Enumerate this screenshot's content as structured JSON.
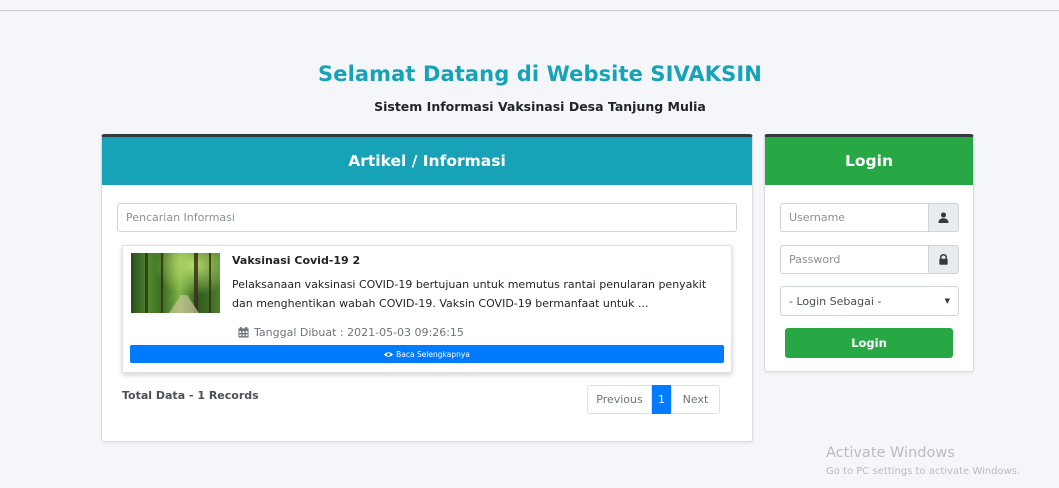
{
  "header": {
    "title": "Selamat Datang di Website SIVAKSIN",
    "subtitle": "Sistem Informasi Vaksinasi Desa Tanjung Mulia"
  },
  "articles": {
    "heading": "Artikel / Informasi",
    "search_placeholder": "Pencarian Informasi",
    "items": [
      {
        "title": "Vaksinasi Covid-19 2",
        "excerpt": "Pelaksanaan vaksinasi COVID-19 bertujuan untuk memutus rantai penularan penyakit dan menghentikan wabah COVID-19. Vaksin COVID-19 bermanfaat untuk ...",
        "date": "Tanggal Dibuat : 2021-05-03 09:26:15",
        "read_more": "Baca Selengkapnya",
        "thumbnail_icon": "forest-photo"
      }
    ],
    "total": "Total Data - 1 Records",
    "pagination": {
      "previous": "Previous",
      "current": "1",
      "next": "Next"
    }
  },
  "login": {
    "heading": "Login",
    "username_placeholder": "Username",
    "password_placeholder": "Password",
    "role_selected": "- Login Sebagai -",
    "submit": "Login"
  },
  "watermark": {
    "title": "Activate Windows",
    "subtitle": "Go to PC settings to activate Windows."
  },
  "colors": {
    "info": "#17a2b8",
    "success": "#28a745",
    "primary": "#007bff",
    "dark": "#343a40"
  }
}
